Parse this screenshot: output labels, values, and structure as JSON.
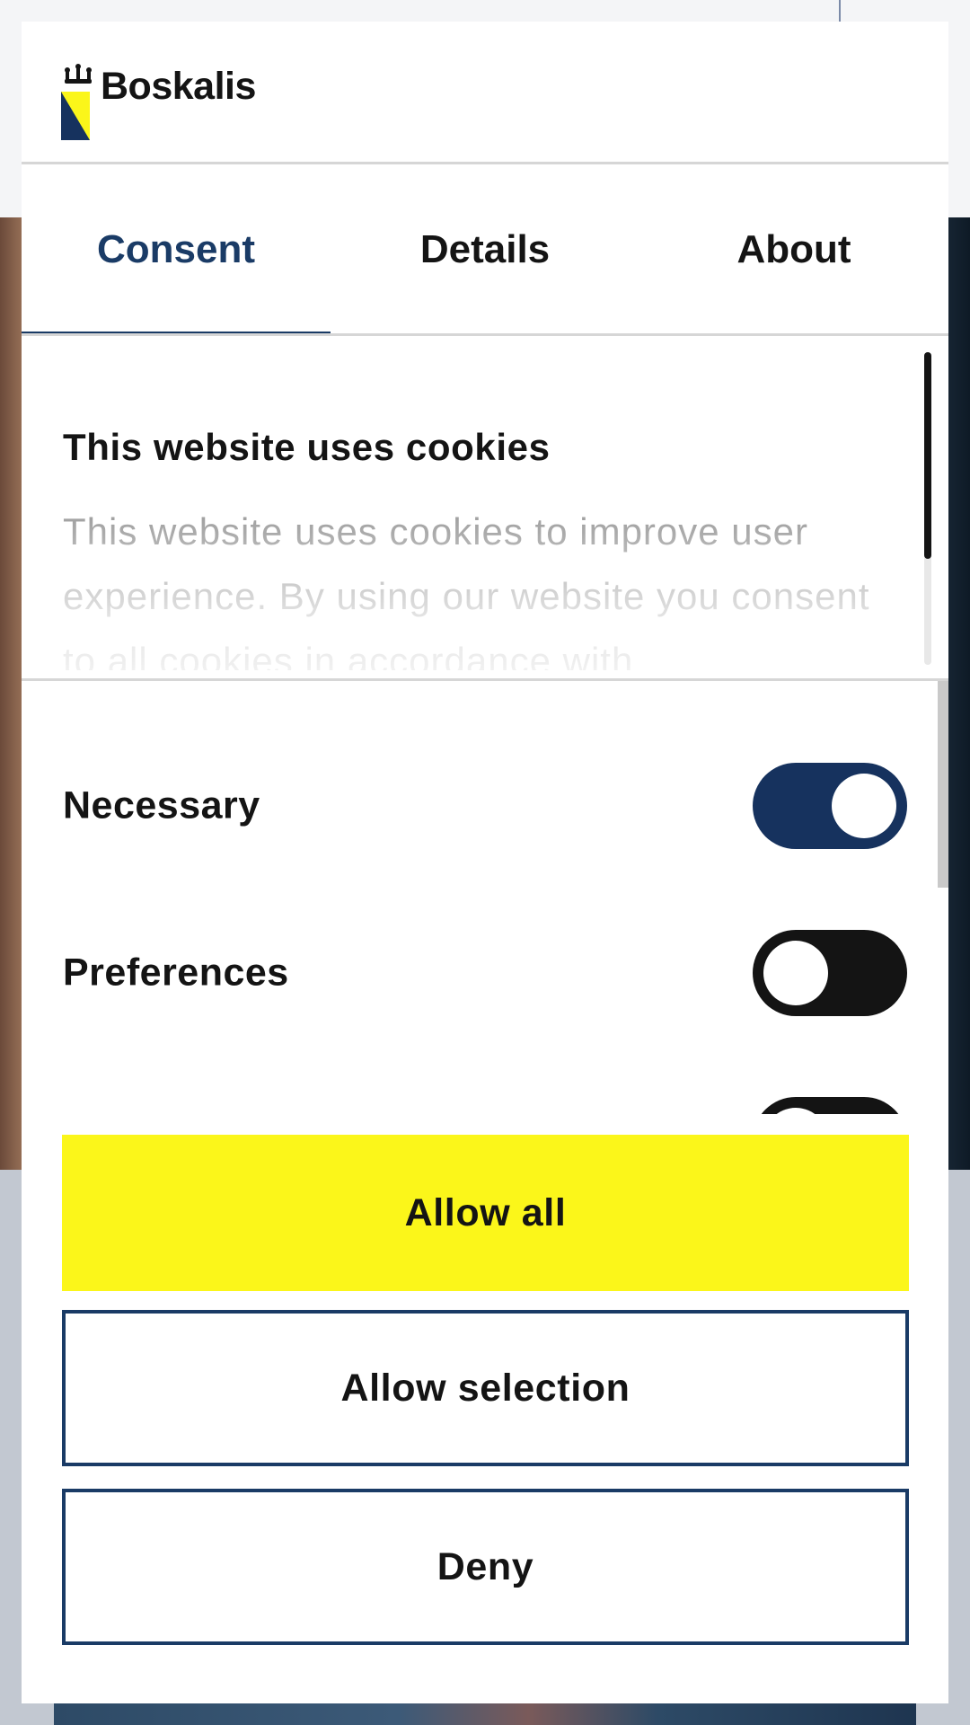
{
  "brand": {
    "name": "Boskalis",
    "accent": "#1a3b66",
    "primary_button_color": "#fbf61a"
  },
  "tabs": [
    {
      "label": "Consent",
      "active": true
    },
    {
      "label": "Details",
      "active": false
    },
    {
      "label": "About",
      "active": false
    }
  ],
  "consent": {
    "title": "This website uses cookies",
    "text": "This website uses cookies to improve user experience. By using our website you consent to all cookies in accordance with"
  },
  "toggles": [
    {
      "label": "Necessary",
      "state": "on"
    },
    {
      "label": "Preferences",
      "state": "off"
    },
    {
      "label": "",
      "state": "off"
    }
  ],
  "buttons": {
    "allow_all": "Allow all",
    "allow_selection": "Allow selection",
    "deny": "Deny"
  },
  "icons": {
    "logo": "crown-flag-logo",
    "knob": "toggle-knob"
  }
}
